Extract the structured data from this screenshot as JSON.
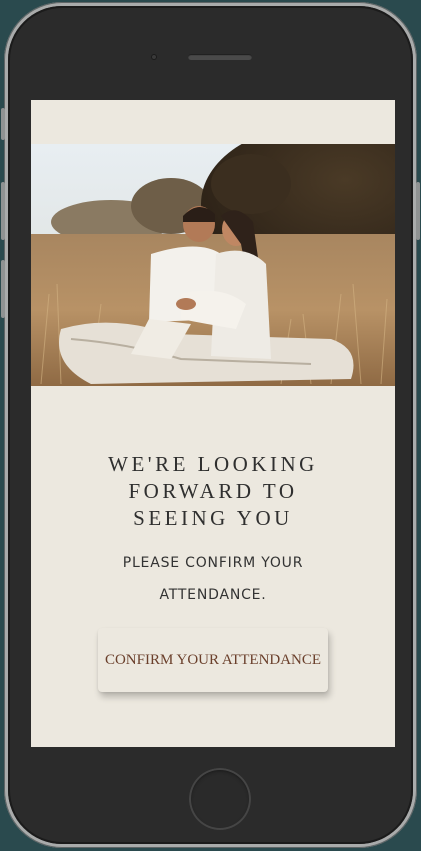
{
  "invitation": {
    "headline": "WE'RE LOOKING\nFORWARD TO\nSEEING YOU",
    "subtext": "PLEASE CONFIRM YOUR ATTENDANCE.",
    "confirm_button_label": "CONFIRM YOUR ATTENDANCE"
  },
  "colors": {
    "page_background": "#2a4a4e",
    "screen_background": "#ece8df",
    "button_text": "#6a3f2b",
    "headline_text": "#2f2f2f"
  }
}
